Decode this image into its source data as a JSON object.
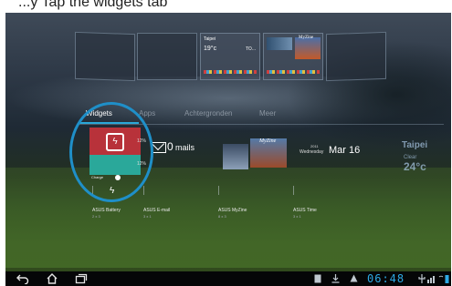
{
  "caption": {
    "text": "...y Tap the widgets tab"
  },
  "home_thumbnails": {
    "weather_mini": {
      "city": "Taipei",
      "temp": "19°c",
      "temp2": "TO..."
    },
    "myzine_mini": {
      "title": "MyZine"
    }
  },
  "tabs": [
    {
      "label": "Widgets",
      "active": true
    },
    {
      "label": "Apps",
      "active": false
    },
    {
      "label": "Achtergronden",
      "active": false
    },
    {
      "label": "Meer",
      "active": false
    }
  ],
  "widgets": {
    "battery": {
      "name": "ASUS Battery",
      "size": "2 x 3",
      "pct_top": "12%",
      "pct_bottom": "12%",
      "charge_label": "Charge",
      "bolt": "ϟ"
    },
    "email": {
      "name": "ASUS E-mail",
      "size": "3 x 1",
      "count": "0",
      "unit": "mails"
    },
    "myzine": {
      "name": "ASUS MyZine",
      "size": "8 x 3",
      "title": "MyZine"
    },
    "time": {
      "name": "ASUS Time",
      "size": "3 x 1",
      "year": "2011",
      "weekday": "Wednesday",
      "date": "Mar 16"
    },
    "weather": {
      "city": "Taipei",
      "condition": "Clear",
      "temp": "24°c"
    }
  },
  "system_bar": {
    "back_icon": "back-icon",
    "home_icon": "home-icon",
    "recents_icon": "recent-apps-icon",
    "time": "06:48",
    "accent": "#2ea9e4"
  },
  "highlight_color": "#1f8fc8"
}
